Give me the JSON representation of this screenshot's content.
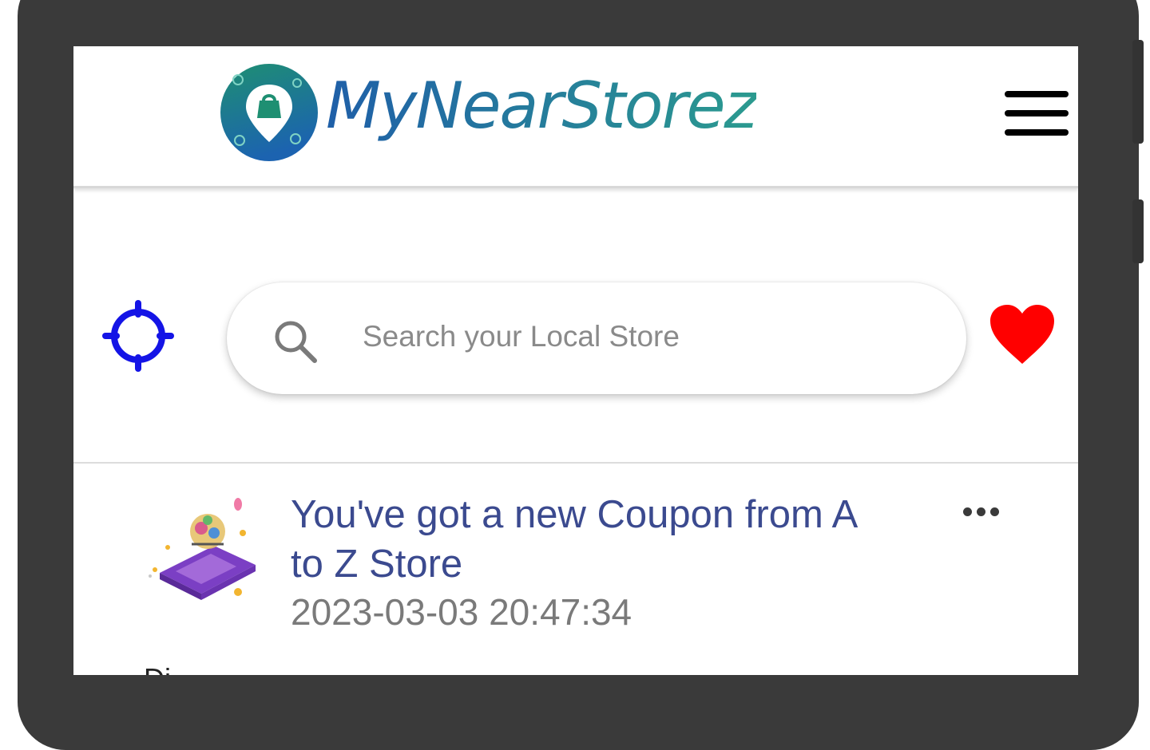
{
  "app": {
    "name": "MyNearStorez"
  },
  "header": {
    "logo_text": "MyNearStorez",
    "menu_icon": "hamburger-menu-icon"
  },
  "search": {
    "placeholder": "Search your Local Store",
    "value": "",
    "icon": "search-icon",
    "locate_icon": "crosshair-location-icon",
    "favorite_icon": "heart-icon"
  },
  "colors": {
    "logo_gradient_start": "#1f5fa8",
    "logo_gradient_end": "#2b9a8f",
    "locate_icon": "#1414e6",
    "favorite_icon": "#ff0000",
    "notification_title": "#3b4a8f",
    "notification_time": "#7a7a7a",
    "device_frame": "#3a3a3a"
  },
  "notifications": [
    {
      "title": "You've got a new Coupon from A to Z Store",
      "time": "2023-03-03 20:47:34",
      "thumbnail_icon": "coupon-gift-icon",
      "more_icon": "more-options-icon"
    }
  ],
  "next_item_partial": "Di"
}
